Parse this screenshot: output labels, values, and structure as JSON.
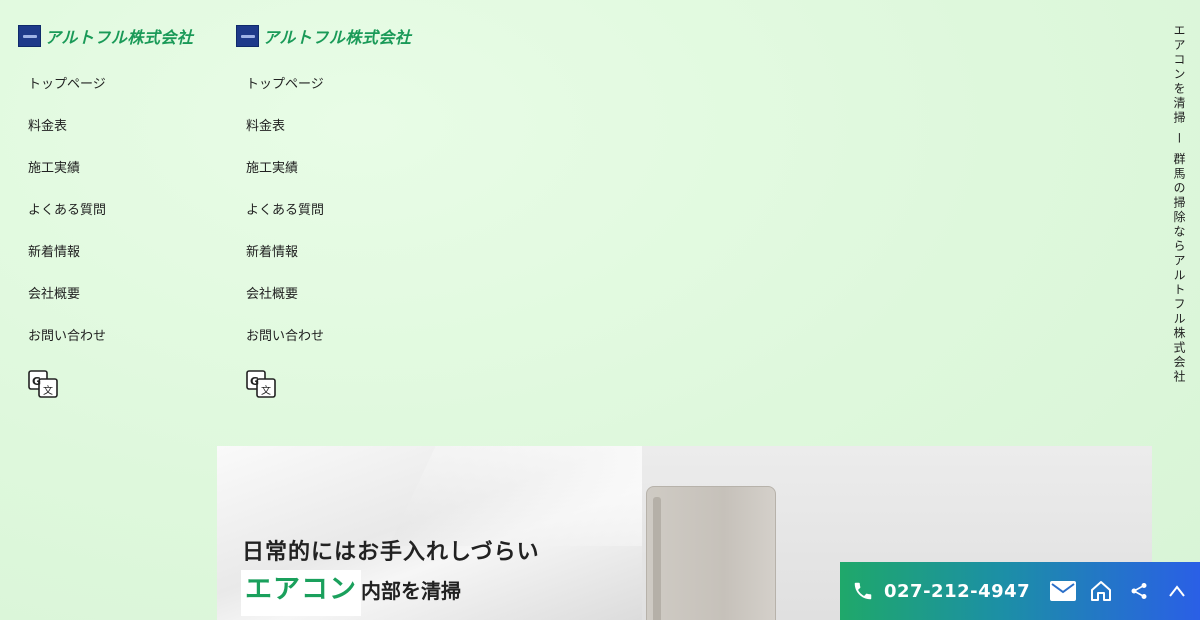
{
  "company": {
    "name": "アルトフル株式会社"
  },
  "nav": {
    "items": [
      "トップページ",
      "料金表",
      "施工実績",
      "よくある質問",
      "新着情報",
      "会社概要",
      "お問い合わせ"
    ]
  },
  "icons": {
    "translate": "translate-icon",
    "phone": "phone-icon",
    "mail": "mail-icon",
    "home": "home-icon",
    "share": "share-icon",
    "up": "chevron-up-icon"
  },
  "side_text": "エアコンを清掃 ー 群馬の掃除ならアルトフル株式会社",
  "hero": {
    "line1": "日常的にはお手入れしづらい",
    "highlight": "エアコン",
    "line2_rest": "内部を清掃"
  },
  "contact": {
    "phone": "027-212-4947"
  },
  "colors": {
    "brand_green": "#1a9a58",
    "bar_start": "#1fa86a",
    "bar_end": "#2a5fe6"
  }
}
